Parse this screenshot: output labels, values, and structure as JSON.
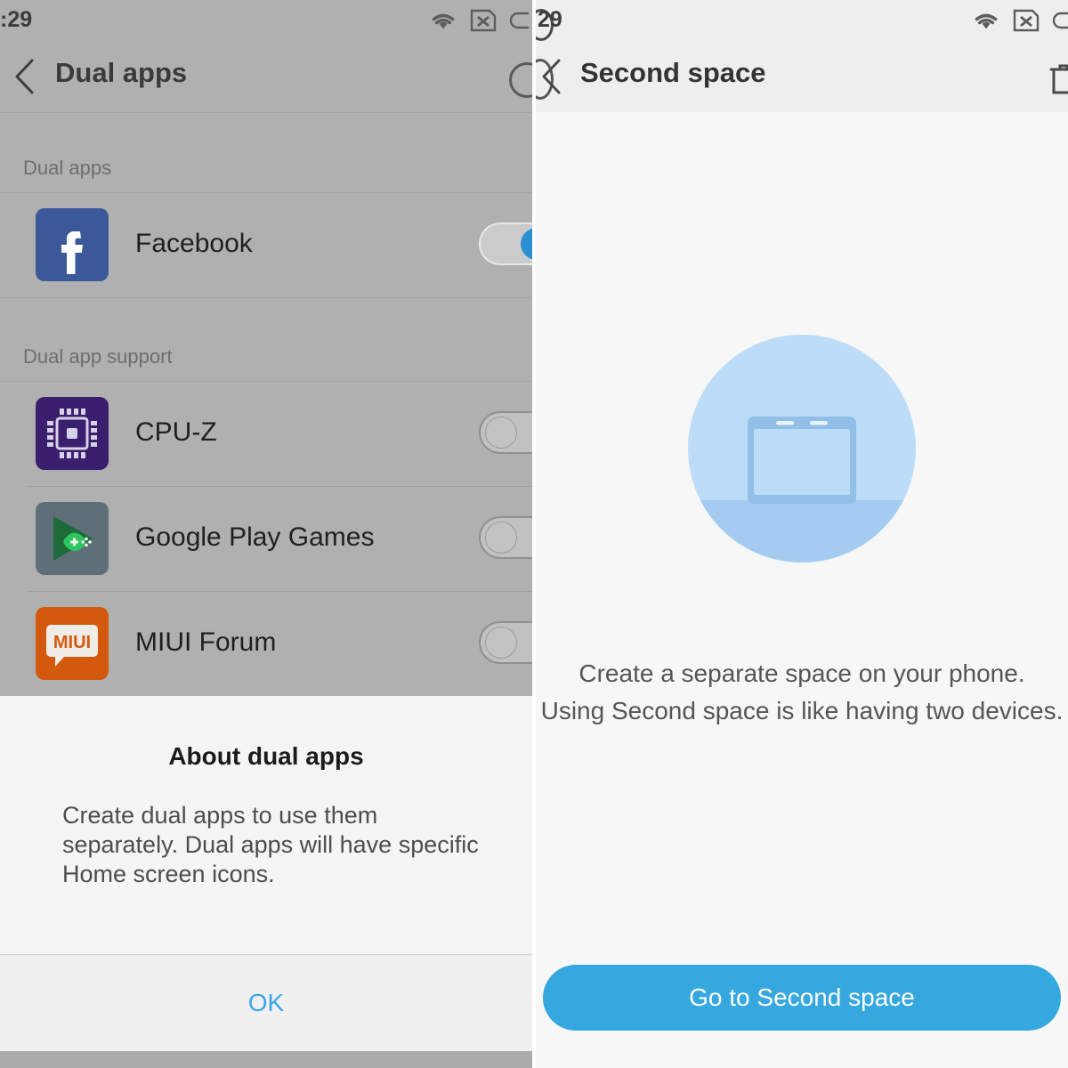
{
  "left_screen": {
    "status_bar": {
      "time": ":29",
      "icons": [
        "wifi-icon",
        "no-sim-icon",
        "battery-icon"
      ]
    },
    "title_bar": {
      "back_icon": "back-chevron-icon",
      "title": "Dual apps",
      "action_icon": "overflow-circle-icon"
    },
    "sections": [
      {
        "label": "Dual apps",
        "items": [
          {
            "name": "Facebook",
            "icon": "facebook-icon",
            "toggle": "on"
          }
        ]
      },
      {
        "label": "Dual app support",
        "items": [
          {
            "name": "CPU-Z",
            "icon": "cpuz-icon",
            "toggle": "off"
          },
          {
            "name": "Google Play Games",
            "icon": "google-play-games-icon",
            "toggle": "off"
          },
          {
            "name": "MIUI Forum",
            "icon": "miui-forum-icon",
            "toggle": "off"
          }
        ]
      }
    ],
    "dialog": {
      "title": "About dual apps",
      "body": "Create dual apps to use them separately. Dual apps will have specific Home screen icons.",
      "ok_label": "OK"
    }
  },
  "right_screen": {
    "status_bar": {
      "time": "29",
      "icons": [
        "wifi-icon",
        "no-sim-icon",
        "battery-icon"
      ]
    },
    "title_bar": {
      "back_icon": "back-chevron-icon",
      "title": "Second space",
      "action_icon": "trash-icon"
    },
    "illustration": "second-space-laptop-illustration",
    "caption_line1": "Create a separate space on your phone.",
    "caption_line2": "Using Second space is like having two devices.",
    "cta_label": "Go to Second space"
  },
  "colors": {
    "accent_blue": "#35a8e0",
    "ok_blue": "#3aa5e8",
    "dim_overlay": "#b0b0b0",
    "dialog_bg": "#f5f5f5",
    "facebook_blue": "#3b5998",
    "cpuz_purple": "#3a1f6e",
    "play_games_slate": "#5f6f78",
    "play_games_green": "#1fa84f",
    "miui_orange": "#d2590e",
    "illus_circle": "#bcdcf7",
    "illus_ground": "#a8cdf0",
    "illus_device": "#92bfe8"
  }
}
